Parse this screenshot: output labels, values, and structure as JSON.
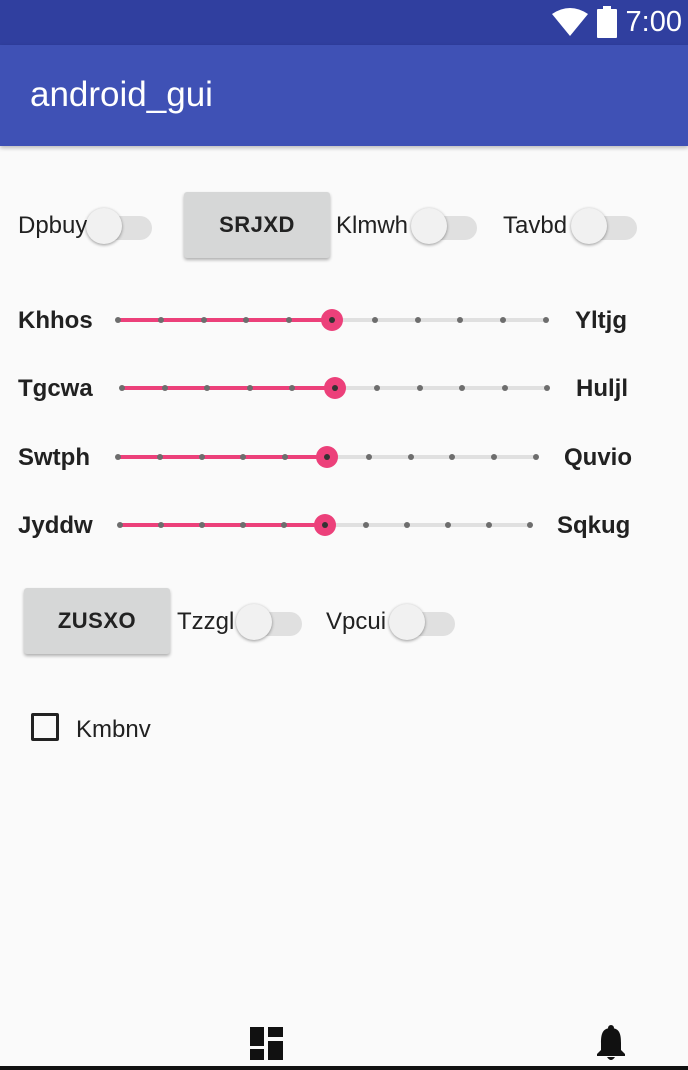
{
  "status_bar": {
    "time": "7:00",
    "wifi_icon": "wifi-icon",
    "battery_icon": "battery-icon"
  },
  "app_bar": {
    "title": "android_gui"
  },
  "row1": {
    "switch1_label": "Dpbuy",
    "button_label": "SRJXD",
    "switch2_label": "Klmwh",
    "switch3_label": "Tavbd"
  },
  "sliders": [
    {
      "left_label": "Khhos",
      "right_label": "Yltjg",
      "steps": 10,
      "value": 5
    },
    {
      "left_label": "Tgcwa",
      "right_label": "Huljl",
      "steps": 10,
      "value": 5
    },
    {
      "left_label": "Swtph",
      "right_label": "Quvio",
      "steps": 10,
      "value": 5
    },
    {
      "left_label": "Jyddw",
      "right_label": "Sqkug",
      "steps": 10,
      "value": 5
    }
  ],
  "row2": {
    "button_label": "ZUSXO",
    "switch1_label": "Tzzgl",
    "switch2_label": "Vpcui"
  },
  "checkbox": {
    "label": "Kmbnv",
    "checked": false
  },
  "bottom_nav": {
    "left_icon": "dashboard-icon",
    "right_icon": "bell-icon"
  },
  "colors": {
    "primary_dark": "#303f9f",
    "primary": "#3f51b5",
    "accent": "#ec407a"
  }
}
